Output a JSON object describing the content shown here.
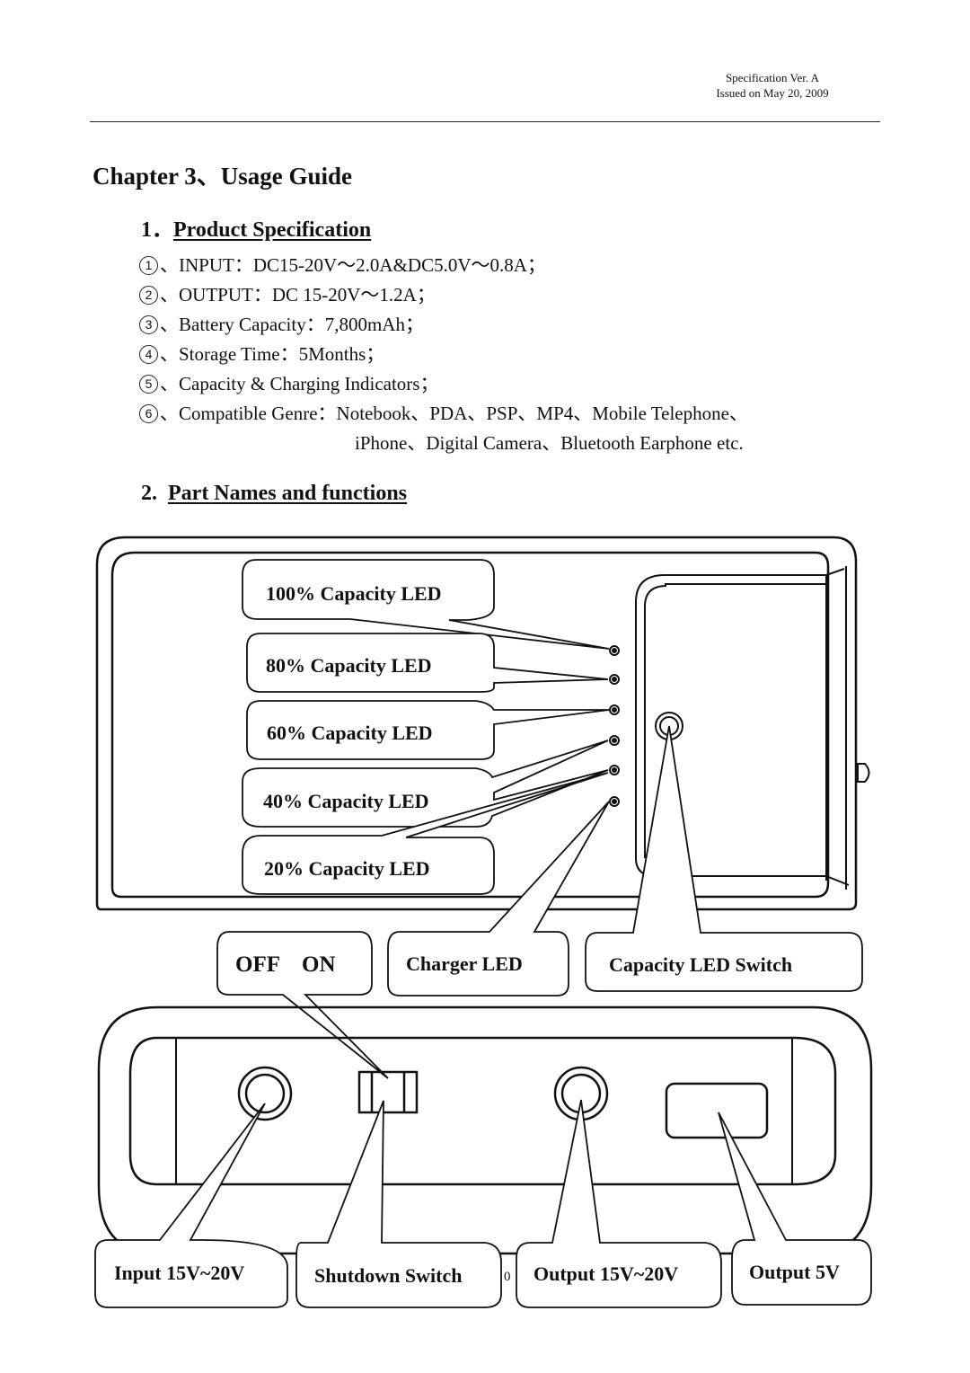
{
  "header": {
    "spec_version": "Specification Ver. A",
    "issued": "Issued on May 20, 2009"
  },
  "chapter_title": "Chapter 3、Usage Guide",
  "section1": {
    "number": "1．",
    "title": "Product Specification",
    "items": [
      {
        "num": "1",
        "text": "、INPUT：DC15-20V～2.0A&DC5.0V～0.8A；"
      },
      {
        "num": "2",
        "text": "、OUTPUT：DC 15-20V～1.2A；"
      },
      {
        "num": "3",
        "text": "、Battery Capacity：7,800mAh；"
      },
      {
        "num": "4",
        "text": "、Storage Time：5Months；"
      },
      {
        "num": "5",
        "text": "、Capacity & Charging Indicators；"
      },
      {
        "num": "6",
        "text": "、Compatible Genre：Notebook、PDA、PSP、MP4、Mobile Telephone、"
      }
    ],
    "item6_continuation": "iPhone、Digital Camera、Bluetooth Earphone etc."
  },
  "section2": {
    "number": "2.",
    "title": "Part Names and functions"
  },
  "diagram": {
    "led_labels": [
      "100% Capacity LED",
      "80% Capacity LED",
      "60% Capacity LED",
      "40% Capacity LED",
      "20% Capacity LED"
    ],
    "switch_label": "OFF    ON",
    "charger_led": "Charger LED",
    "capacity_switch": "Capacity LED Switch",
    "bottom_labels": [
      "Input 15V~20V",
      "Shutdown Switch",
      "Output 15V~20V",
      "Output 5V"
    ],
    "page_mark": "0"
  }
}
